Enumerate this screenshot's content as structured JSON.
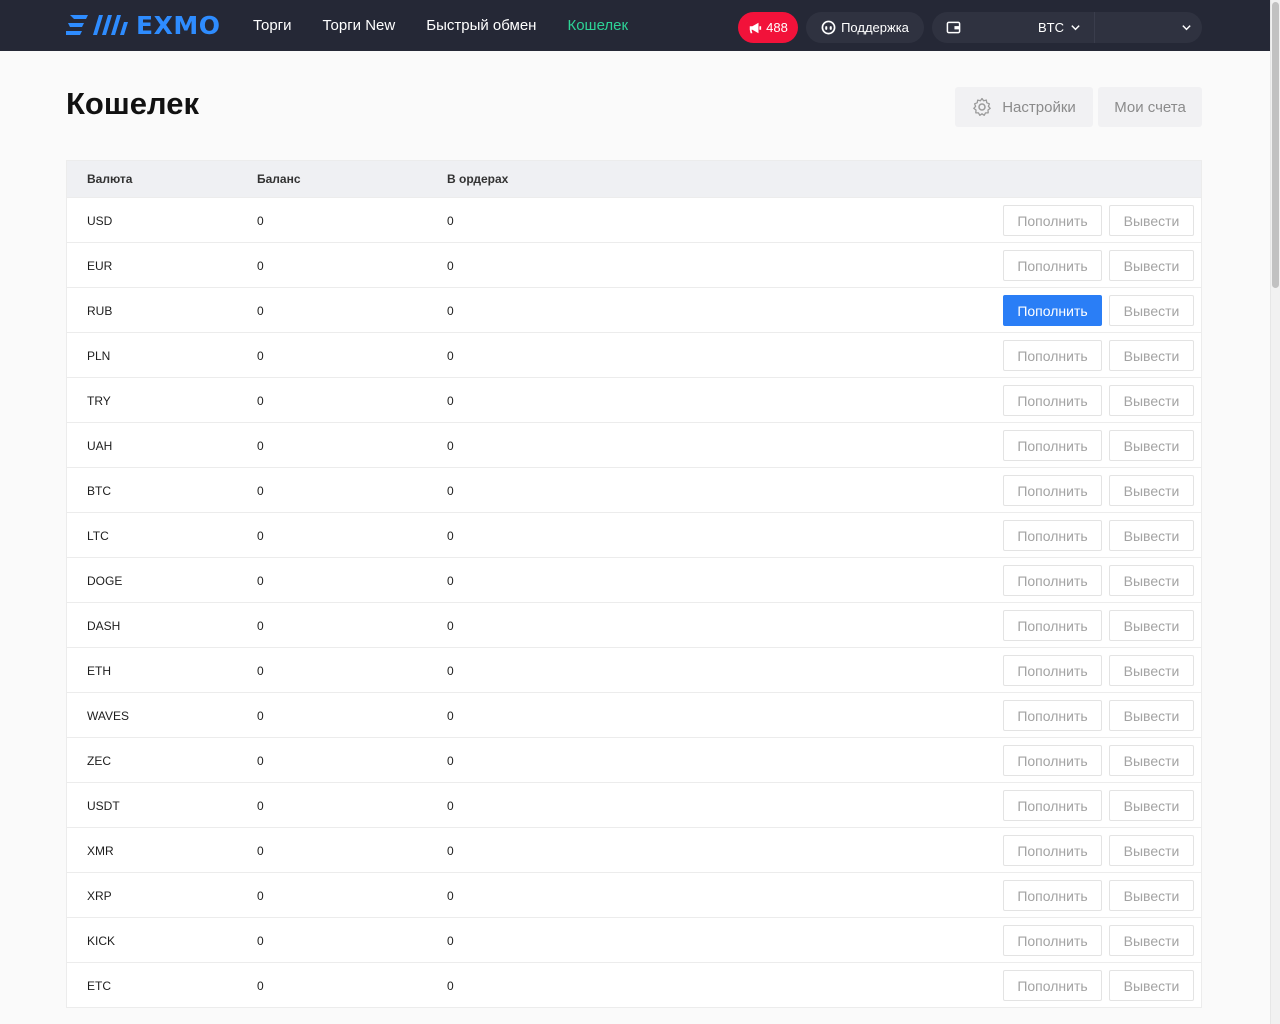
{
  "brand": {
    "name": "EXMO",
    "color": "#2e8cff"
  },
  "nav": {
    "items": [
      {
        "label": "Торги",
        "active": false
      },
      {
        "label": "Торги New",
        "active": false
      },
      {
        "label": "Быстрый обмен",
        "active": false
      },
      {
        "label": "Кошелек",
        "active": true
      }
    ]
  },
  "header": {
    "notifications": {
      "count": "488",
      "icon": "megaphone-icon",
      "color": "#f2123a"
    },
    "support": {
      "label": "Поддержка",
      "icon": "support-icon"
    },
    "wallet": {
      "icon": "wallet-icon",
      "currency": "BTC"
    }
  },
  "page": {
    "title": "Кошелек",
    "settings_label": "Настройки",
    "accounts_label": "Мои счета"
  },
  "table": {
    "columns": [
      "Валюта",
      "Баланс",
      "В ордерах"
    ],
    "deposit_label": "Пополнить",
    "withdraw_label": "Вывести",
    "highlight_deposit_row": "RUB",
    "accent_color": "#2a7ef6",
    "rows": [
      {
        "currency": "USD",
        "balance": "0",
        "in_orders": "0"
      },
      {
        "currency": "EUR",
        "balance": "0",
        "in_orders": "0"
      },
      {
        "currency": "RUB",
        "balance": "0",
        "in_orders": "0"
      },
      {
        "currency": "PLN",
        "balance": "0",
        "in_orders": "0"
      },
      {
        "currency": "TRY",
        "balance": "0",
        "in_orders": "0"
      },
      {
        "currency": "UAH",
        "balance": "0",
        "in_orders": "0"
      },
      {
        "currency": "BTC",
        "balance": "0",
        "in_orders": "0"
      },
      {
        "currency": "LTC",
        "balance": "0",
        "in_orders": "0"
      },
      {
        "currency": "DOGE",
        "balance": "0",
        "in_orders": "0"
      },
      {
        "currency": "DASH",
        "balance": "0",
        "in_orders": "0"
      },
      {
        "currency": "ETH",
        "balance": "0",
        "in_orders": "0"
      },
      {
        "currency": "WAVES",
        "balance": "0",
        "in_orders": "0"
      },
      {
        "currency": "ZEC",
        "balance": "0",
        "in_orders": "0"
      },
      {
        "currency": "USDT",
        "balance": "0",
        "in_orders": "0"
      },
      {
        "currency": "XMR",
        "balance": "0",
        "in_orders": "0"
      },
      {
        "currency": "XRP",
        "balance": "0",
        "in_orders": "0"
      },
      {
        "currency": "KICK",
        "balance": "0",
        "in_orders": "0"
      },
      {
        "currency": "ETC",
        "balance": "0",
        "in_orders": "0"
      }
    ]
  }
}
